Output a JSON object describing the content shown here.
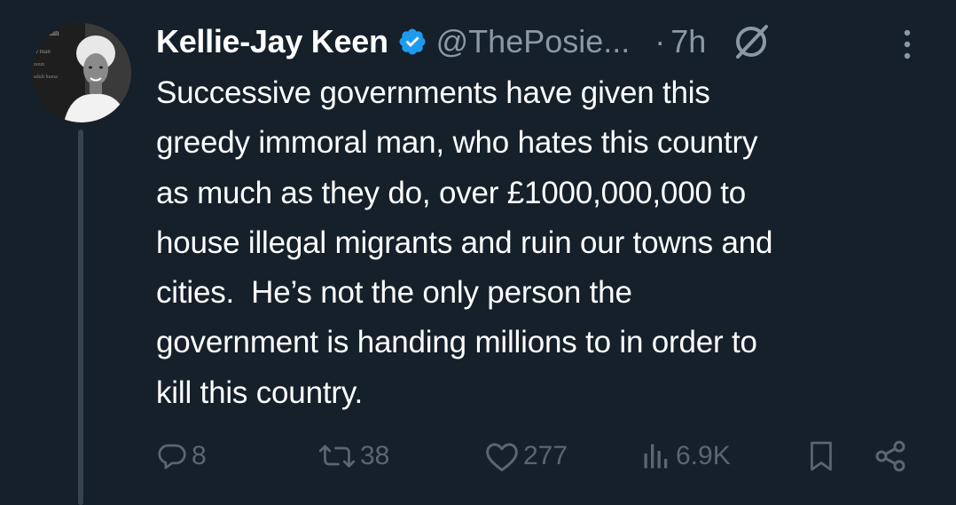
{
  "tweet": {
    "author_name": "Kellie-Jay Keen",
    "handle": "@ThePosie...",
    "separator": "·",
    "time": "7h",
    "text": "Successive governments have given this\ngreedy immoral man, who hates this country\nas much as they do, over £1000,000,000 to\nhouse illegal migrants and ruin our towns and\ncities.  He’s not the only person the\ngovernment is handing millions to in order to\nkill this country."
  },
  "actions": {
    "replies": "8",
    "reposts": "38",
    "likes": "277",
    "views": "6.9K"
  },
  "avatar_text": {
    "line1": "woman",
    "line2": "w man",
    "line3": "noun",
    "line4": "adult huma"
  },
  "colors": {
    "background": "#15202b",
    "text_primary": "#ffffff",
    "text_secondary": "#8b98a5",
    "action_icons": "#5b6670",
    "verified_badge": "#1d9bf0",
    "thread_line": "#38444d"
  },
  "icons": {
    "verified": "verified-badge-icon",
    "grok": "grok-icon",
    "more": "more-vertical-icon",
    "reply": "reply-icon",
    "repost": "repost-icon",
    "like": "heart-icon",
    "views": "views-chart-icon",
    "bookmark": "bookmark-icon",
    "share": "share-icon"
  }
}
